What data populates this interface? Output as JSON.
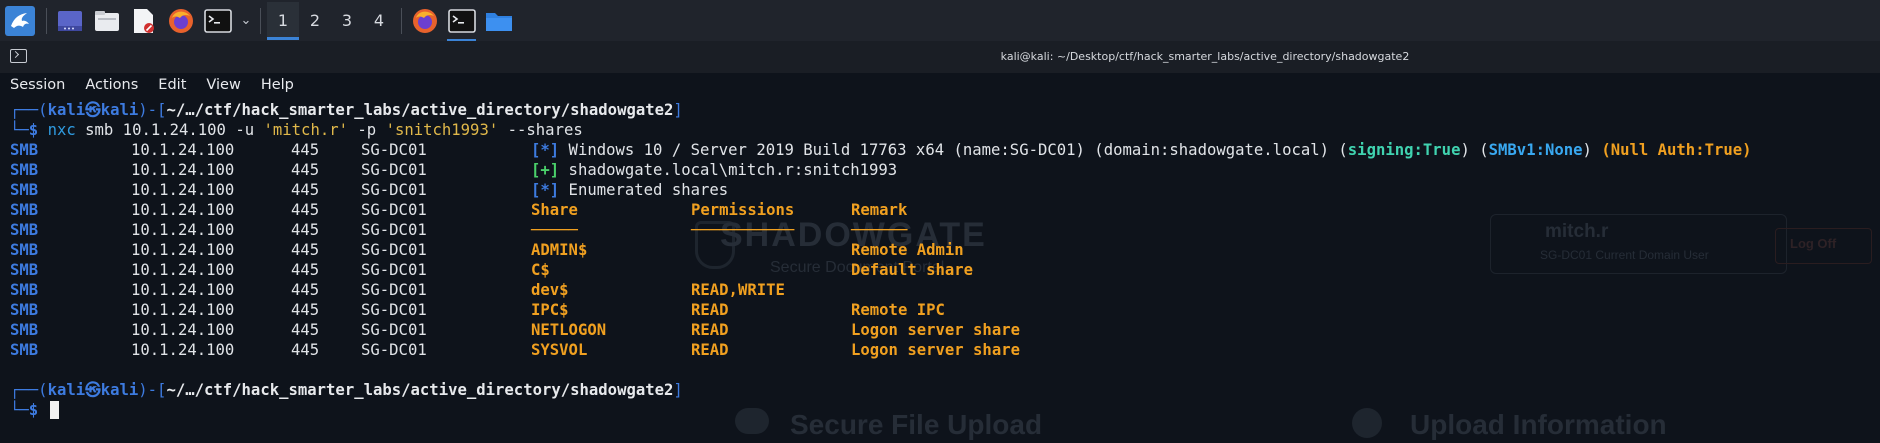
{
  "taskbar": {
    "workspaces": [
      "1",
      "2",
      "3",
      "4"
    ],
    "active_workspace": "1",
    "apps": [
      "kali-menu-icon",
      "desktop-icon",
      "file-manager-icon",
      "text-editor-icon",
      "firefox-icon",
      "terminal-icon",
      "chevron-down-icon"
    ],
    "accent": "#3b83d6"
  },
  "window": {
    "title": "kali@kali: ~/Desktop/ctf/hack_smarter_labs/active_directory/shadowgate2"
  },
  "menu": [
    "Session",
    "Actions",
    "Edit",
    "View",
    "Help"
  ],
  "prompt": {
    "top_left": "┌──(",
    "user": "kali㉿kali",
    "mid": ")-[",
    "path": "~/…/ctf/hack_smarter_labs/active_directory/shadowgate2",
    "close": "]",
    "bottom_left": "└─",
    "dollar": "$"
  },
  "command": {
    "bin": "nxc",
    "args1": " smb 10.1.24.100 -u ",
    "user_str": "'mitch.r'",
    "args2": " -p ",
    "pass_str": "'snitch1993'",
    "args3": " --shares"
  },
  "rows": {
    "proto": "SMB",
    "host": "10.1.24.100",
    "port": "445",
    "name": "SG-DC01"
  },
  "info1": {
    "tag": "[*]",
    "text": " Windows 10 / Server 2019 Build 17763 x64 (name:SG-DC01) (domain:shadowgate.local) (",
    "signing": "signing:True",
    "mid": ") (",
    "smbv1": "SMBv1:None",
    "mid2": ") ",
    "null_auth": "(Null Auth:True)"
  },
  "info2": {
    "tag": "[+]",
    "text": " shadowgate.local\\mitch.r:snitch1993"
  },
  "info3": {
    "tag": "[*]",
    "text": " Enumerated shares"
  },
  "shares_table": {
    "headers": [
      "Share",
      "Permissions",
      "Remark"
    ],
    "separator": [
      "─────",
      "───────────",
      "──────"
    ],
    "rows": [
      [
        "ADMIN$",
        "",
        "Remote Admin"
      ],
      [
        "C$",
        "",
        "Default share"
      ],
      [
        "dev$",
        "READ,WRITE",
        ""
      ],
      [
        "IPC$",
        "READ",
        "Remote IPC"
      ],
      [
        "NETLOGON",
        "READ",
        "Logon server share"
      ],
      [
        "SYSVOL",
        "READ",
        "Logon server share"
      ]
    ]
  },
  "ghost_page": {
    "brand": "SHADOWGATE",
    "sub": "Secure Document Portal",
    "user": "mitch.r",
    "user_sub": "SG-DC01 Current Domain User",
    "logout": "Log Off",
    "upload": "Secure File Upload",
    "info": "Upload Information"
  }
}
